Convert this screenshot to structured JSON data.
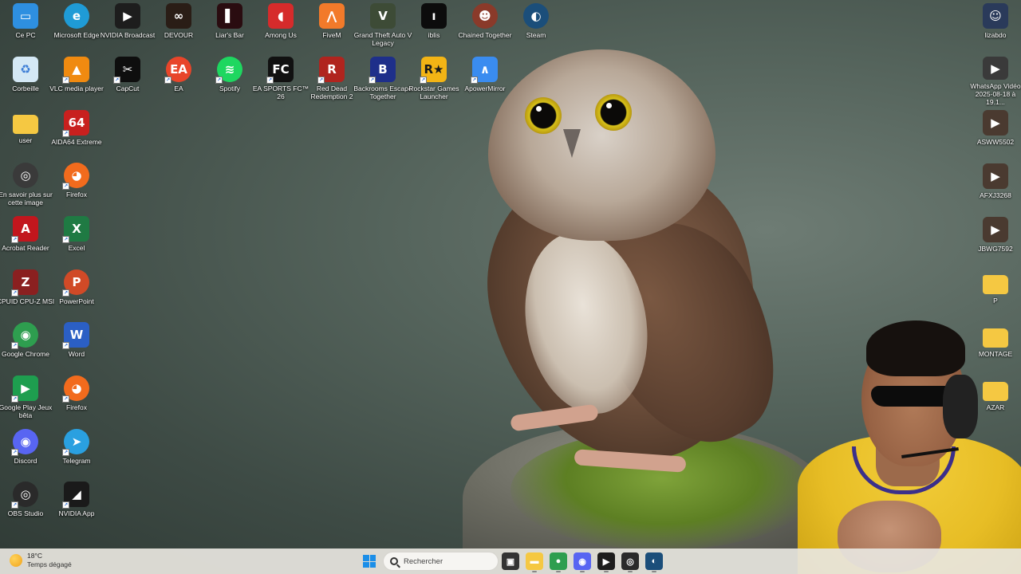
{
  "desktop": {
    "left_icons": [
      {
        "label": "Ce PC",
        "icon": "monitor-icon",
        "color": "#2e8fe0"
      },
      {
        "label": "Microsoft Edge",
        "icon": "edge-icon",
        "color": "#1f9bd6"
      },
      {
        "label": "NVIDIA Broadcast",
        "icon": "nvidia-broadcast-icon",
        "color": "#1d1d1d"
      },
      {
        "label": "DEVOUR",
        "icon": "devour-icon",
        "color": "#2a1d16"
      },
      {
        "label": "Liar's Bar",
        "icon": "liars-bar-icon",
        "color": "#2a0c10"
      },
      {
        "label": "Among Us",
        "icon": "among-us-icon",
        "color": "#d62b2b"
      },
      {
        "label": "FiveM",
        "icon": "fivem-icon",
        "color": "#f27a2a"
      },
      {
        "label": "Grand Theft Auto V Legacy",
        "icon": "gta-icon",
        "color": "#3d4b36"
      },
      {
        "label": "iblis",
        "icon": "iblis-icon",
        "color": "#0c0c0c"
      },
      {
        "label": "Chained Together",
        "icon": "chained-together-icon",
        "color": "#8a3a2a"
      },
      {
        "label": "Steam",
        "icon": "steam-icon",
        "color": "#1b4e7a"
      },
      {
        "label": "Corbeille",
        "icon": "recycle-bin-icon",
        "color": "#d4e8f5"
      },
      {
        "label": "VLC media player",
        "icon": "vlc-icon",
        "color": "#f08a10"
      },
      {
        "label": "CapCut",
        "icon": "capcut-icon",
        "color": "#0e0e0e"
      },
      {
        "label": "EA",
        "icon": "ea-icon",
        "color": "#e8452a"
      },
      {
        "label": "Spotify",
        "icon": "spotify-icon",
        "color": "#1ed760"
      },
      {
        "label": "EA SPORTS FC™ 26",
        "icon": "ea-fc-icon",
        "color": "#111111"
      },
      {
        "label": "Red Dead Redemption 2",
        "icon": "rdr2-icon",
        "color": "#b0241e"
      },
      {
        "label": "Backrooms Escape Together",
        "icon": "backrooms-icon",
        "color": "#1e2f8a"
      },
      {
        "label": "Rockstar Games Launcher",
        "icon": "rockstar-icon",
        "color": "#f3b415"
      },
      {
        "label": "ApowerMirror",
        "icon": "apowermirror-icon",
        "color": "#3a8cf0"
      },
      {
        "label": "user",
        "icon": "folder-icon",
        "color": "#f5c842"
      },
      {
        "label": "AIDA64 Extreme",
        "icon": "aida64-icon",
        "color": "#c8201e"
      },
      {
        "label": "En savoir plus sur cette image",
        "icon": "info-camera-icon",
        "color": "#3a3a3a"
      },
      {
        "label": "Firefox",
        "icon": "firefox-icon",
        "color": "#f26b1d"
      },
      {
        "label": "Acrobat Reader",
        "icon": "acrobat-icon",
        "color": "#c2161d"
      },
      {
        "label": "Excel",
        "icon": "excel-icon",
        "color": "#1f7a43"
      },
      {
        "label": "CPUID CPU-Z MSI",
        "icon": "cpuz-icon",
        "color": "#8a2020"
      },
      {
        "label": "PowerPoint",
        "icon": "powerpoint-icon",
        "color": "#d04a27"
      },
      {
        "label": "Google Chrome",
        "icon": "chrome-icon",
        "color": "#2e9e4f"
      },
      {
        "label": "Word",
        "icon": "word-icon",
        "color": "#2b5fc4"
      },
      {
        "label": "Google Play Jeux bêta",
        "icon": "google-play-games-icon",
        "color": "#1e9e4f"
      },
      {
        "label": "Firefox",
        "icon": "firefox-icon",
        "color": "#f26b1d"
      },
      {
        "label": "Discord",
        "icon": "discord-icon",
        "color": "#5865f2"
      },
      {
        "label": "Telegram",
        "icon": "telegram-icon",
        "color": "#2aa0e0"
      },
      {
        "label": "OBS Studio",
        "icon": "obs-icon",
        "color": "#2a2a2a"
      },
      {
        "label": "NVIDIA App",
        "icon": "nvidia-app-icon",
        "color": "#1a1a1a"
      }
    ],
    "right_icons": [
      {
        "label": "lizabdo",
        "icon": "user-folder-icon",
        "color": "#2a3a5a"
      },
      {
        "label": "WhatsApp Vidéo 2025-08-18 à 19.1...",
        "icon": "video-file-icon",
        "color": "#3a3a3a"
      },
      {
        "label": "ASWW5502",
        "icon": "video-file-icon",
        "color": "#4a3a30"
      },
      {
        "label": "AFXJ3268",
        "icon": "video-file-icon",
        "color": "#4a3a30"
      },
      {
        "label": "JBWG7592",
        "icon": "video-file-icon",
        "color": "#4a3a30"
      },
      {
        "label": "P",
        "icon": "folder-icon",
        "color": "#f5c842"
      },
      {
        "label": "MONTAGE",
        "icon": "folder-icon",
        "color": "#f5c842"
      },
      {
        "label": "AZAR",
        "icon": "folder-icon",
        "color": "#f5c842"
      }
    ]
  },
  "taskbar": {
    "weather_temp": "18°C",
    "weather_desc": "Temps dégagé",
    "search_placeholder": "Rechercher",
    "apps": [
      {
        "name": "task-view",
        "glyph": "▣",
        "color": "#333333"
      },
      {
        "name": "file-explorer",
        "glyph": "▬",
        "color": "#f5c842"
      },
      {
        "name": "chrome",
        "glyph": "●",
        "color": "#2e9e4f"
      },
      {
        "name": "discord",
        "glyph": "◉",
        "color": "#5865f2"
      },
      {
        "name": "nvidia-broadcast",
        "glyph": "▶",
        "color": "#1d1d1d"
      },
      {
        "name": "obs",
        "glyph": "◎",
        "color": "#2a2a2a"
      },
      {
        "name": "steam",
        "glyph": "◐",
        "color": "#1b4e7a"
      }
    ]
  }
}
